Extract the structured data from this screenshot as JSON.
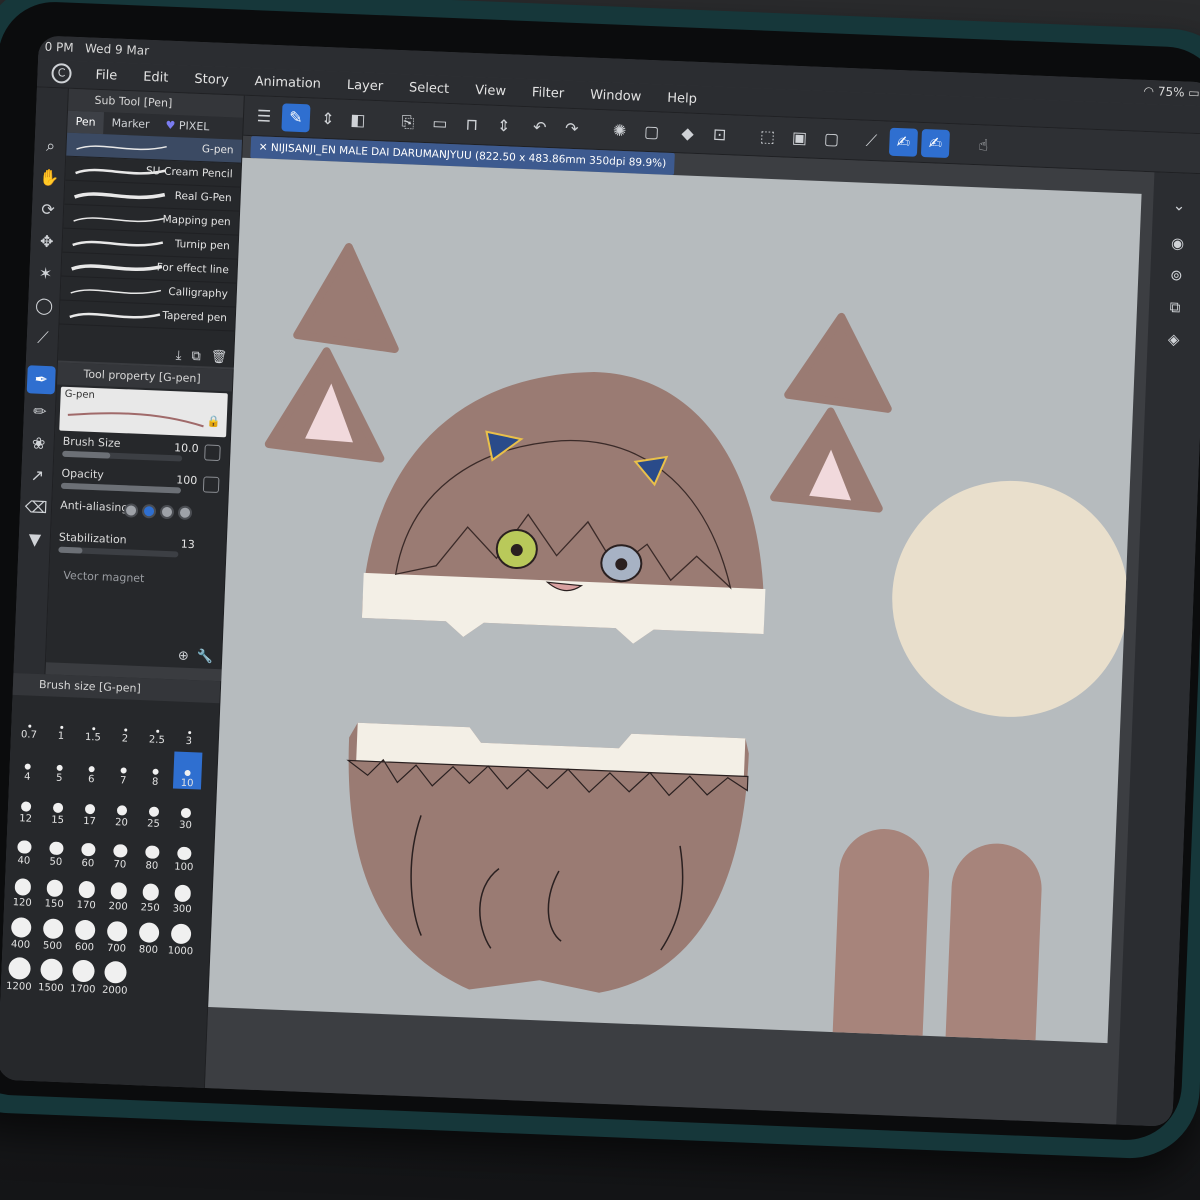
{
  "status": {
    "time": "0 PM",
    "date": "Wed 9 Mar",
    "battery": "75%"
  },
  "menu": [
    "File",
    "Edit",
    "Story",
    "Animation",
    "Layer",
    "Select",
    "View",
    "Filter",
    "Window",
    "Help"
  ],
  "subtool": {
    "title": "Sub Tool [Pen]",
    "tabs": [
      "Pen",
      "Marker",
      "PIXEL"
    ],
    "brushes": [
      "G-pen",
      "SU-Cream Pencil",
      "Real G-Pen",
      "Mapping pen",
      "Turnip pen",
      "For effect line",
      "Calligraphy",
      "Tapered pen"
    ],
    "selected": "G-pen"
  },
  "toolprop": {
    "title": "Tool property [G-pen]",
    "preview_label": "G-pen",
    "brush_size_label": "Brush Size",
    "brush_size": "10.0",
    "opacity_label": "Opacity",
    "opacity": "100",
    "antialias_label": "Anti-aliasing",
    "stabilization_label": "Stabilization",
    "stabilization": "13",
    "vector_label": "Vector magnet"
  },
  "brushsize": {
    "title": "Brush size [G-pen]",
    "sizes": [
      "0.7",
      "1",
      "1.5",
      "2",
      "2.5",
      "3",
      "4",
      "5",
      "6",
      "7",
      "8",
      "10",
      "12",
      "15",
      "17",
      "20",
      "25",
      "30",
      "40",
      "50",
      "60",
      "70",
      "80",
      "100",
      "120",
      "150",
      "170",
      "200",
      "250",
      "300",
      "400",
      "500",
      "600",
      "700",
      "800",
      "1000",
      "1200",
      "1500",
      "1700",
      "2000"
    ],
    "selected": "10"
  },
  "document": {
    "tab": "NIJISANJI_EN MALE DAI DARUMANJYUU (822.50 x 483.86mm 350dpi 89.9%)"
  },
  "colors": {
    "hair": "#9a7b73",
    "skin": "#f3efe6",
    "ear_inner": "#f1d9dc",
    "circle": "#e9dfcc",
    "accent": "#2f6fd0",
    "eye_left": "#b9c95a",
    "eye_right": "#a7b2c4"
  }
}
